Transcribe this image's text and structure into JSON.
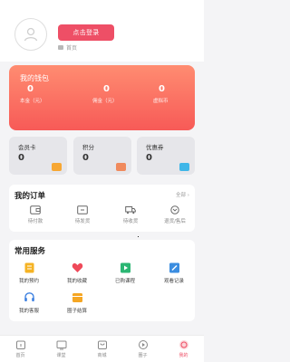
{
  "profile": {
    "login_label": "点击登录",
    "homepage_label": "首页"
  },
  "wallet": {
    "title": "我的钱包",
    "items": [
      {
        "value": "0",
        "label": "本金（元）"
      },
      {
        "value": "0",
        "label": "佣金（元）"
      },
      {
        "value": "0",
        "label": "虚拟币"
      }
    ]
  },
  "stats": [
    {
      "label": "会员卡",
      "value": "0",
      "icon": "card-icon",
      "color": "#f7a733"
    },
    {
      "label": "积分",
      "value": "0",
      "icon": "points-icon",
      "color": "#f08a5d"
    },
    {
      "label": "优惠券",
      "value": "0",
      "icon": "coupon-icon",
      "color": "#3fb6e8"
    }
  ],
  "orders": {
    "title": "我的订单",
    "all_label": "全部",
    "items": [
      {
        "label": "待付款",
        "icon": "wallet-icon"
      },
      {
        "label": "待发货",
        "icon": "box-icon"
      },
      {
        "label": "待收货",
        "icon": "truck-icon"
      },
      {
        "label": "退货/售后",
        "icon": "refund-icon"
      }
    ]
  },
  "services": {
    "title": "常用服务",
    "items": [
      {
        "label": "我的预约",
        "icon": "appointment-icon",
        "color": "#f5b324"
      },
      {
        "label": "我的收藏",
        "icon": "heart-icon",
        "color": "#ef4a5a"
      },
      {
        "label": "已购课程",
        "icon": "course-icon",
        "color": "#2bb673"
      },
      {
        "label": "观看记录",
        "icon": "history-icon",
        "color": "#3b8de0"
      },
      {
        "label": "我的客服",
        "icon": "service-icon",
        "color": "#3b7fe0"
      },
      {
        "label": "圈子结算",
        "icon": "circle-settle-icon",
        "color": "#f5a623"
      }
    ]
  },
  "tabbar": {
    "items": [
      {
        "label": "首页",
        "icon": "home-icon",
        "active": false
      },
      {
        "label": "课堂",
        "icon": "classroom-icon",
        "active": false
      },
      {
        "label": "商城",
        "icon": "mall-icon",
        "active": false
      },
      {
        "label": "圈子",
        "icon": "circle-icon",
        "active": false
      },
      {
        "label": "我的",
        "icon": "mine-icon",
        "active": true
      }
    ],
    "active_color": "#ee4f66"
  }
}
